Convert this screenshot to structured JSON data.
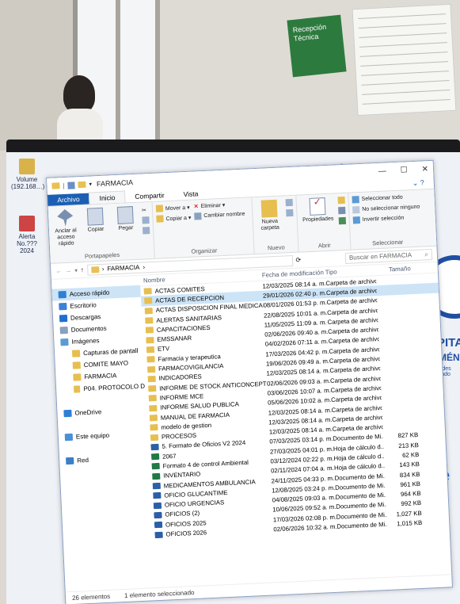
{
  "background": {
    "poster_text": "Recepción Técnica"
  },
  "desktop_icons": [
    {
      "label": "Volume (192.168…)"
    },
    {
      "label": "Alerta No.??? 2024"
    },
    {
      "label": ""
    }
  ],
  "hospital_logo": {
    "line1": "SPITA",
    "line2": "JIMÉNE",
    "line3": "Cubides Hurtado"
  },
  "window": {
    "title": "FARMACIA",
    "tabs": [
      "Archivo",
      "Inicio",
      "Compartir",
      "Vista"
    ],
    "ribbon": {
      "portapapeles": {
        "name": "Portapapeles",
        "anclar": "Anclar al acceso rápido",
        "copiar": "Copiar",
        "pegar": "Pegar"
      },
      "organizar": {
        "name": "Organizar",
        "mover": "Mover a ▾",
        "copiar_a": "Copiar a ▾",
        "eliminar": "Eliminar ▾",
        "cambiar": "Cambiar nombre"
      },
      "nuevo": {
        "name": "Nuevo",
        "nueva_carpeta": "Nueva carpeta"
      },
      "abrir": {
        "name": "Abrir",
        "propiedades": "Propiedades"
      },
      "seleccionar": {
        "name": "Seleccionar",
        "todo": "Seleccionar todo",
        "ninguno": "No seleccionar ninguno",
        "invertir": "Invertir selección"
      }
    },
    "address": {
      "path": "FARMACIA",
      "search_placeholder": "Buscar en FARMACIA"
    },
    "nav": [
      {
        "label": "Acceso rápido",
        "color": "#2f7fd6",
        "selected": true,
        "sub": false
      },
      {
        "label": "Escritorio",
        "color": "#3b82d6",
        "selected": false,
        "sub": false
      },
      {
        "label": "Descargas",
        "color": "#1f6fd1",
        "selected": false,
        "sub": false
      },
      {
        "label": "Documentos",
        "color": "#8aa0bf",
        "selected": false,
        "sub": false
      },
      {
        "label": "Imágenes",
        "color": "#5b9bd5",
        "selected": false,
        "sub": false
      },
      {
        "label": "Capturas de pantall",
        "color": "#e7bf50",
        "selected": false,
        "sub": true
      },
      {
        "label": "COMITE MAYO",
        "color": "#e7bf50",
        "selected": false,
        "sub": true
      },
      {
        "label": "FARMACIA",
        "color": "#e7bf50",
        "selected": false,
        "sub": true
      },
      {
        "label": "P04. PROTOCOLO D",
        "color": "#e7bf50",
        "selected": false,
        "sub": true
      },
      {
        "label": "",
        "color": "#fff",
        "selected": false,
        "sub": false
      },
      {
        "label": "OneDrive",
        "color": "#2f7fd6",
        "selected": false,
        "sub": false
      },
      {
        "label": "",
        "color": "#fff",
        "selected": false,
        "sub": false
      },
      {
        "label": "Este equipo",
        "color": "#4a8fd8",
        "selected": false,
        "sub": false
      },
      {
        "label": "",
        "color": "#fff",
        "selected": false,
        "sub": false
      },
      {
        "label": "Red",
        "color": "#3a7fc8",
        "selected": false,
        "sub": false
      }
    ],
    "columns": [
      "Nombre",
      "Fecha de modificación",
      "Tipo",
      "Tamaño"
    ],
    "files": [
      {
        "name": "ACTAS COMITES",
        "date": "12/03/2025 08:14 a. m.",
        "type": "Carpeta de archivos",
        "size": "",
        "kind": "folder"
      },
      {
        "name": "ACTAS DE RECEPCION",
        "date": "29/01/2026 02:40 p. m.",
        "type": "Carpeta de archivos",
        "size": "",
        "kind": "folder",
        "selected": true
      },
      {
        "name": "ACTAS DISPOSICION FINAL MEDICAMEN...",
        "date": "08/01/2026 01:53 p. m.",
        "type": "Carpeta de archivos",
        "size": "",
        "kind": "folder"
      },
      {
        "name": "ALERTAS SANITARIAS",
        "date": "22/08/2025 10:01 a. m.",
        "type": "Carpeta de archivos",
        "size": "",
        "kind": "folder"
      },
      {
        "name": "CAPACITACIONES",
        "date": "11/05/2025 11:09 a. m.",
        "type": "Carpeta de archivos",
        "size": "",
        "kind": "folder"
      },
      {
        "name": "EMSSANAR",
        "date": "02/06/2026 09:40 a. m.",
        "type": "Carpeta de archivos",
        "size": "",
        "kind": "folder"
      },
      {
        "name": "ETV",
        "date": "04/02/2026 07:11 a. m.",
        "type": "Carpeta de archivos",
        "size": "",
        "kind": "folder"
      },
      {
        "name": "Farmacia y terapeutica",
        "date": "17/03/2026 04:42 p. m.",
        "type": "Carpeta de archivos",
        "size": "",
        "kind": "folder"
      },
      {
        "name": "FARMACOVIGILANCIA",
        "date": "19/06/2026 09:49 a. m.",
        "type": "Carpeta de archivos",
        "size": "",
        "kind": "folder"
      },
      {
        "name": "INDICADORES",
        "date": "12/03/2025 08:14 a. m.",
        "type": "Carpeta de archivos",
        "size": "",
        "kind": "folder"
      },
      {
        "name": "INFORME DE STOCK ANTICONCEPTIVOS",
        "date": "02/06/2026 09:03 a. m.",
        "type": "Carpeta de archivos",
        "size": "",
        "kind": "folder"
      },
      {
        "name": "INFORME MCE",
        "date": "03/06/2026 10:07 a. m.",
        "type": "Carpeta de archivos",
        "size": "",
        "kind": "folder"
      },
      {
        "name": "INFORME SALUD PUBLICA",
        "date": "05/06/2026 10:02 a. m.",
        "type": "Carpeta de archivos",
        "size": "",
        "kind": "folder"
      },
      {
        "name": "MANUAL DE FARMACIA",
        "date": "12/03/2025 08:14 a. m.",
        "type": "Carpeta de archivos",
        "size": "",
        "kind": "folder"
      },
      {
        "name": "modelo de gestion",
        "date": "12/03/2025 08:14 a. m.",
        "type": "Carpeta de archivos",
        "size": "",
        "kind": "folder"
      },
      {
        "name": "PROCESOS",
        "date": "12/03/2025 08:14 a. m.",
        "type": "Carpeta de archivos",
        "size": "",
        "kind": "folder"
      },
      {
        "name": "5. Formato de Oficios V2 2024",
        "date": "07/03/2025 03:14 p. m.",
        "type": "Documento de Mi...",
        "size": "827 KB",
        "kind": "doc"
      },
      {
        "name": "2067",
        "date": "27/03/2025 04:01 p. m.",
        "type": "Hoja de cálculo d...",
        "size": "213 KB",
        "kind": "xls"
      },
      {
        "name": "Formato 4 de control Ambiental",
        "date": "03/12/2024 02:22 p. m.",
        "type": "Hoja de cálculo d...",
        "size": "62 KB",
        "kind": "xls"
      },
      {
        "name": "INVENTARIO",
        "date": "02/11/2024 07:04 a. m.",
        "type": "Hoja de cálculo d...",
        "size": "143 KB",
        "kind": "xls"
      },
      {
        "name": "MEDICAMENTOS AMBULANCIA",
        "date": "24/11/2025 04:33 p. m.",
        "type": "Documento de Mi...",
        "size": "834 KB",
        "kind": "doc"
      },
      {
        "name": "OFICIO GLUCANTIME",
        "date": "12/08/2025 03:24 p. m.",
        "type": "Documento de Mi...",
        "size": "961 KB",
        "kind": "doc"
      },
      {
        "name": "OFICIO URGENCIAS",
        "date": "04/08/2025 09:03 a. m.",
        "type": "Documento de Mi...",
        "size": "964 KB",
        "kind": "doc"
      },
      {
        "name": "OFICIOS (2)",
        "date": "10/06/2025 09:52 a. m.",
        "type": "Documento de Mi...",
        "size": "992 KB",
        "kind": "doc"
      },
      {
        "name": "OFICIOS 2025",
        "date": "17/03/2026 02:08 p. m.",
        "type": "Documento de Mi...",
        "size": "1,027 KB",
        "kind": "doc"
      },
      {
        "name": "OFICIOS 2026",
        "date": "02/06/2026 10:32 a. m.",
        "type": "Documento de Mi...",
        "size": "1,015 KB",
        "kind": "doc"
      }
    ],
    "status": {
      "count": "26 elementos",
      "selected": "1 elemento seleccionado"
    }
  }
}
